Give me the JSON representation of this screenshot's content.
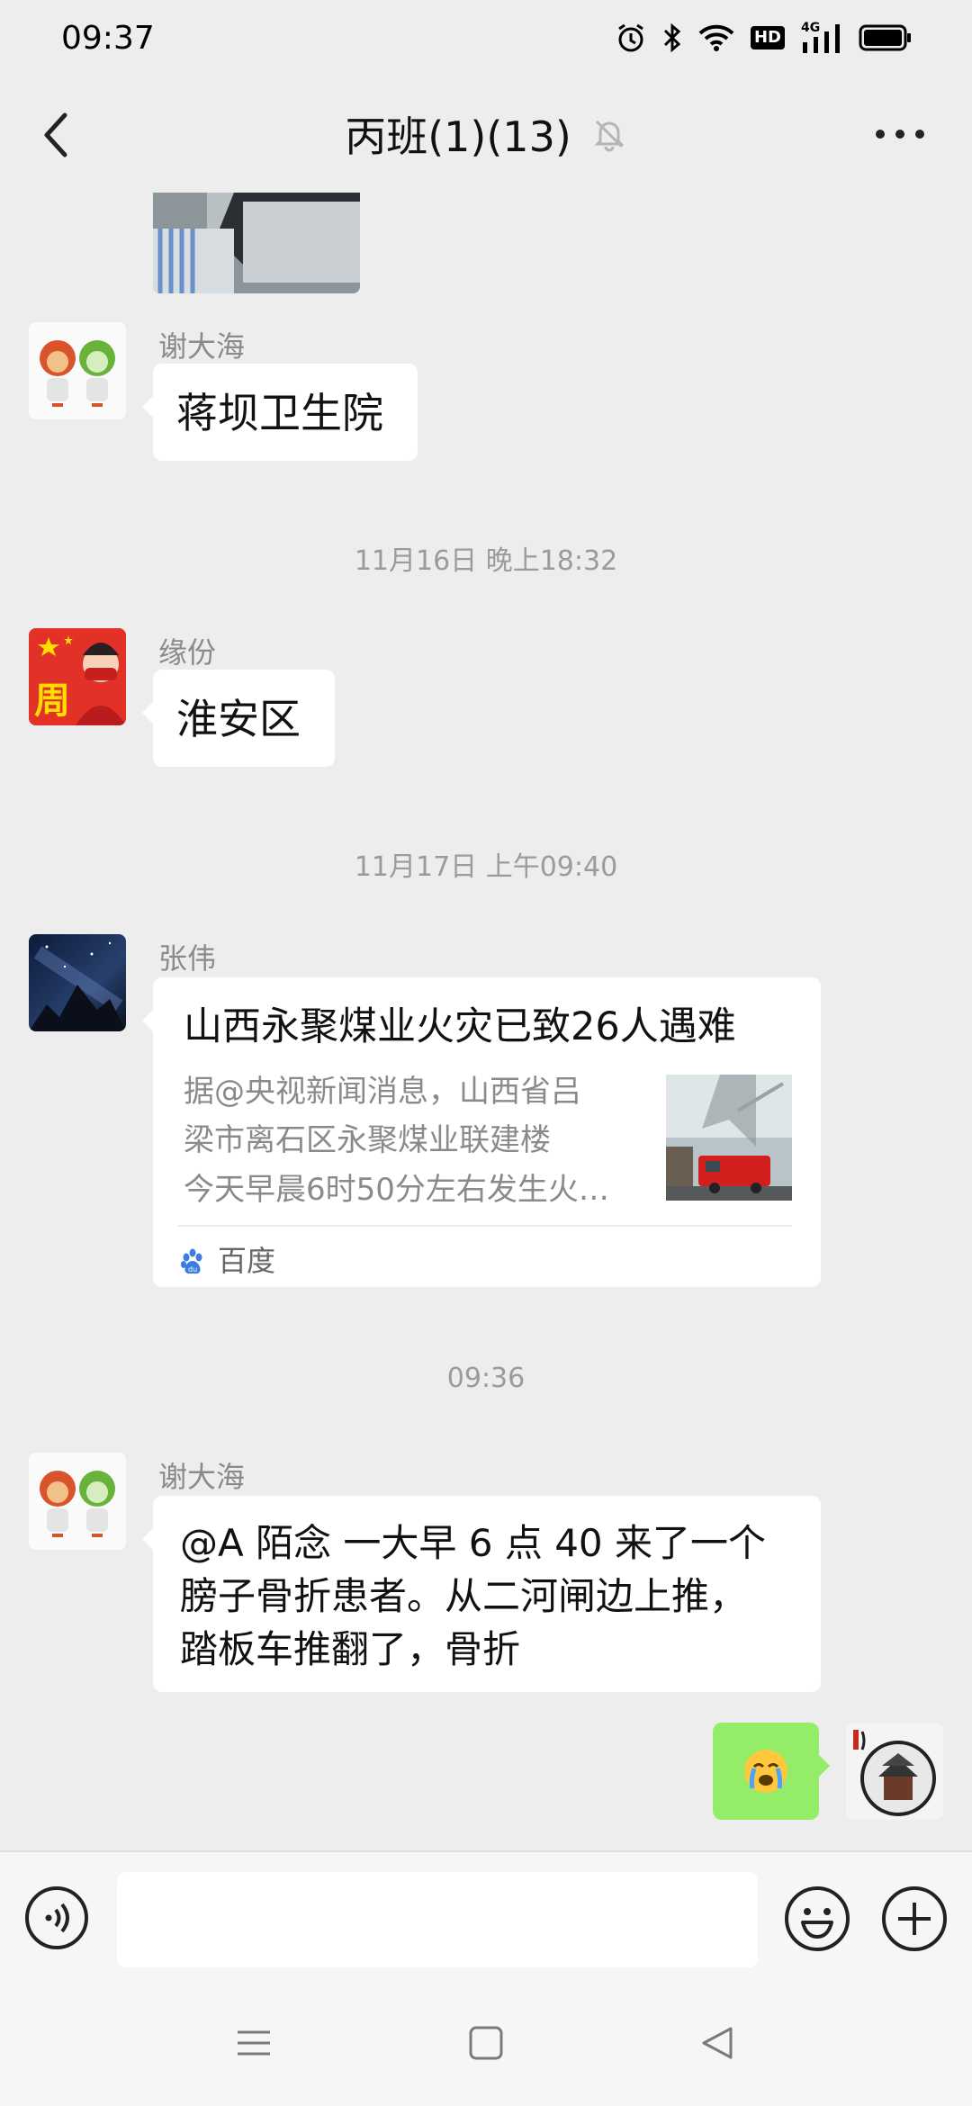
{
  "status_bar": {
    "time": "09:37",
    "icons": [
      "alarm-icon",
      "bluetooth-icon",
      "wifi-icon",
      "hd-icon",
      "4g-signal-icon",
      "battery-icon"
    ],
    "hd_label": "HD",
    "network_label": "4G"
  },
  "nav": {
    "title": "丙班(1)(13)",
    "back_icon": "chevron-left-icon",
    "mute_icon": "bell-off-icon",
    "more_icon": "more-icon"
  },
  "messages": [
    {
      "type": "image",
      "sender": "",
      "avatar": "mascot-avatar"
    },
    {
      "type": "text",
      "sender": "谢大海",
      "text": "蒋坝卫生院",
      "avatar": "mascot-avatar"
    },
    {
      "type": "timestamp",
      "text": "11月16日 晚上18:32"
    },
    {
      "type": "text",
      "sender": "缘份",
      "text": "淮安区",
      "avatar": "flag-avatar",
      "avatar_char": "周"
    },
    {
      "type": "timestamp",
      "text": "11月17日 上午09:40"
    },
    {
      "type": "link_card",
      "sender": "张伟",
      "avatar": "night-sky-avatar",
      "title": "山西永聚煤业火灾已致26人遇难",
      "desc_lines": [
        "据@央视新闻消息，山西省吕",
        "梁市离石区永聚煤业联建楼",
        "今天早晨6时50分左右发生火…"
      ],
      "source": "百度",
      "source_icon": "baidu-paw-icon"
    },
    {
      "type": "timestamp",
      "text": "09:36"
    },
    {
      "type": "text",
      "sender": "谢大海",
      "avatar": "mascot-avatar",
      "lines": [
        "@A 陌念  一大早 6 点 40 来了一个",
        "膀子骨折患者。从二河闸边上推，",
        "踏板车推翻了，骨折"
      ]
    },
    {
      "type": "self_emoji",
      "emoji": "😭",
      "avatar": "pavilion-avatar"
    }
  ],
  "input_bar": {
    "placeholder": "",
    "voice_icon": "voice-icon",
    "emoji_icon": "emoji-icon",
    "plus_icon": "plus-icon"
  },
  "system_nav": [
    "menu-icon",
    "home-icon",
    "back-triangle-icon"
  ],
  "colors": {
    "background": "#ededed",
    "bubble_self": "#95ec69",
    "bubble_other": "#ffffff",
    "timestamp": "#9b9b9b"
  }
}
